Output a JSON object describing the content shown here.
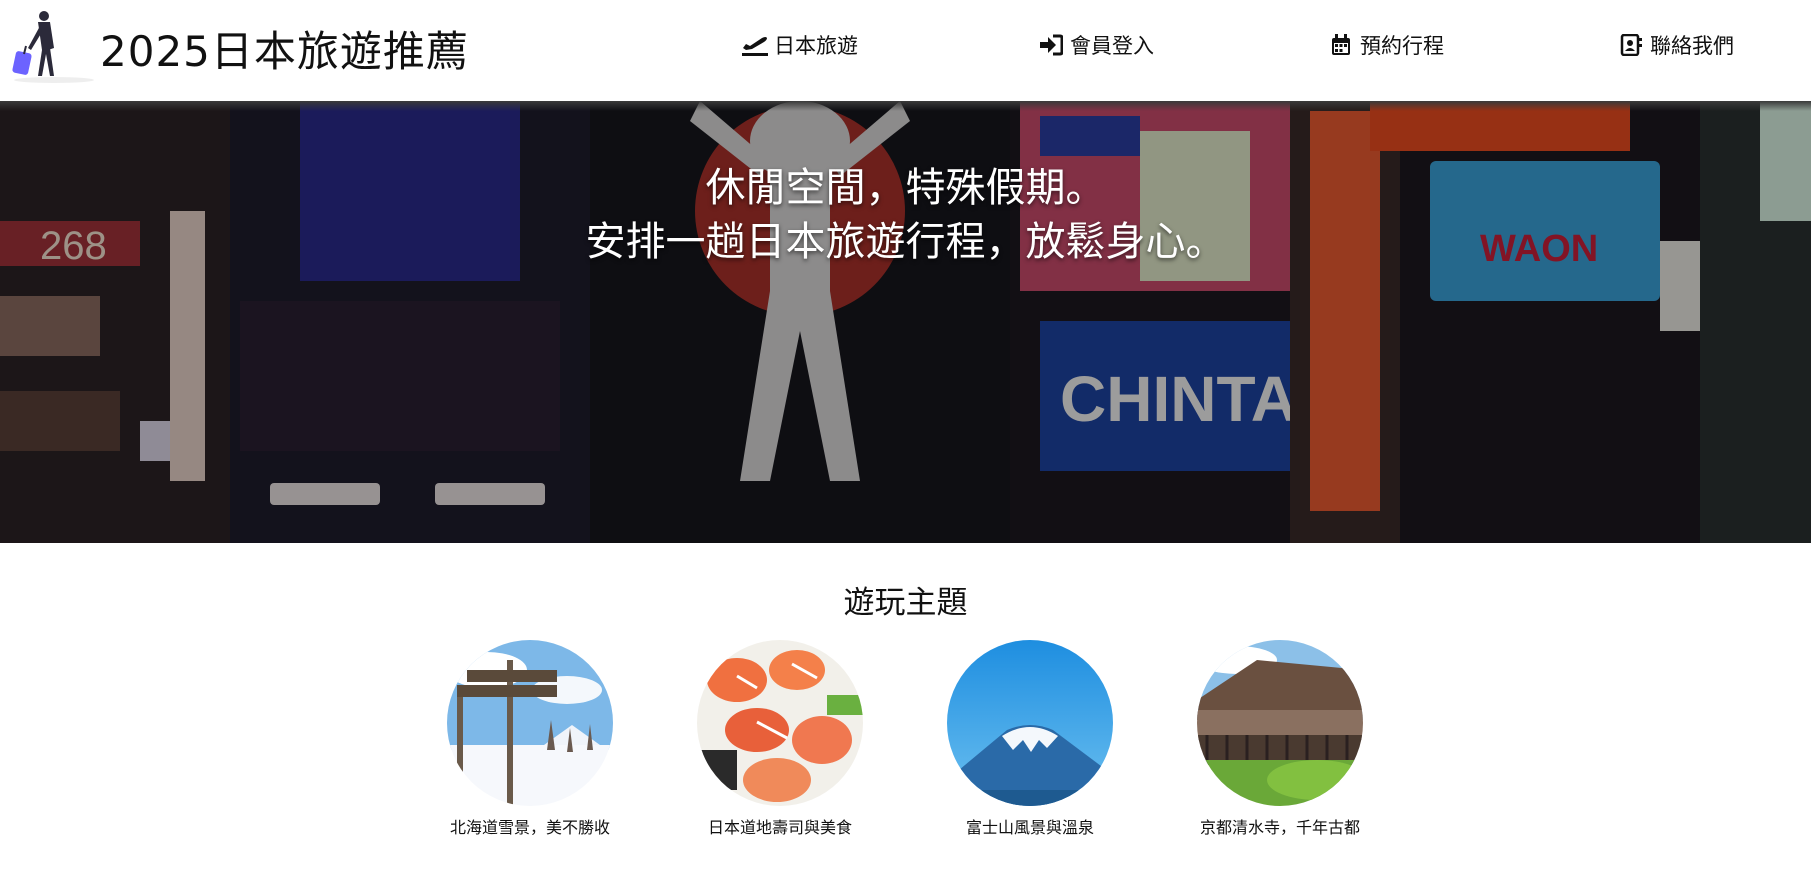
{
  "header": {
    "title": "2025日本旅遊推薦",
    "nav": [
      {
        "label": "日本旅遊",
        "icon": "plane-departure-icon"
      },
      {
        "label": "會員登入",
        "icon": "sign-in-icon"
      },
      {
        "label": "預約行程",
        "icon": "calendar-icon"
      },
      {
        "label": "聯絡我們",
        "icon": "address-book-icon"
      }
    ]
  },
  "hero": {
    "line1": "休閒空間，特殊假期。",
    "line2": "安排一趟日本旅遊行程，放鬆身心。"
  },
  "themes": {
    "title": "遊玩主題",
    "items": [
      {
        "caption": "北海道雪景，美不勝收"
      },
      {
        "caption": "日本道地壽司與美食"
      },
      {
        "caption": "富士山風景與溫泉"
      },
      {
        "caption": "京都清水寺，千年古都"
      }
    ]
  }
}
